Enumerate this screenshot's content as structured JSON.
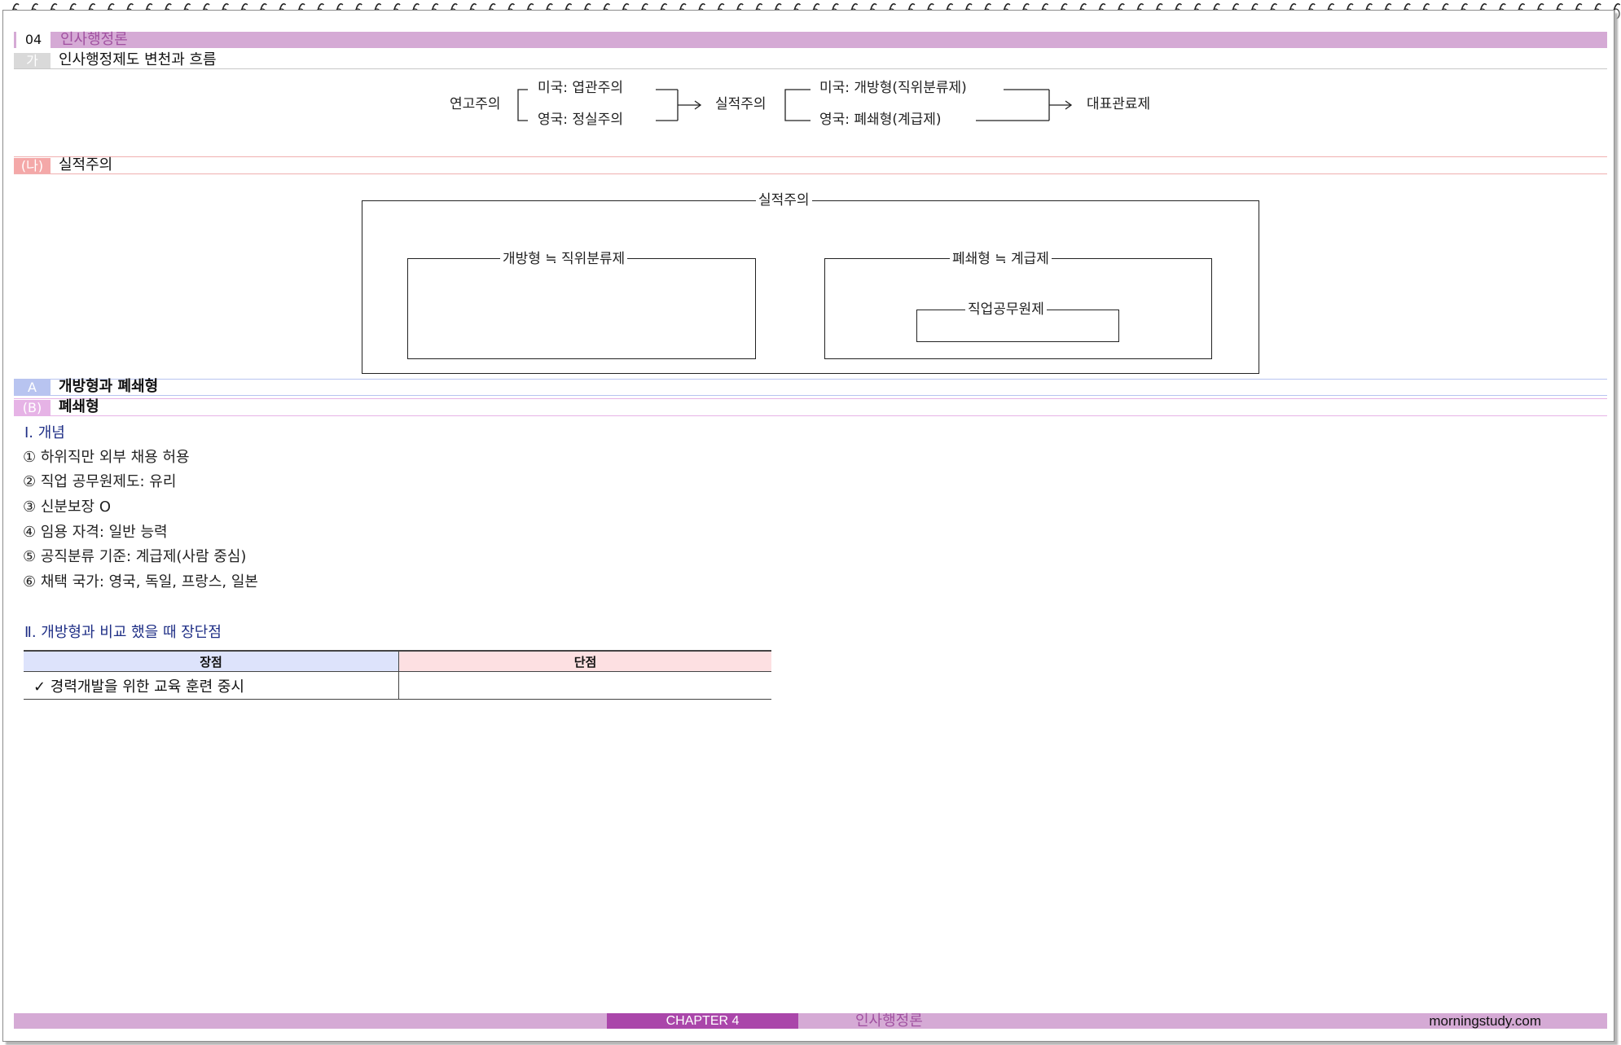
{
  "header": {
    "number": "04",
    "title": "인사행정론"
  },
  "section_ga": {
    "badge": "가",
    "title": "인사행정제도 변천과 흐름"
  },
  "flow": {
    "start": "연고주의",
    "us_patronage": "미국: 엽관주의",
    "uk_patronage": "영국: 정실주의",
    "merit": "실적주의",
    "us_merit": "미국: 개방형(직위분류제)",
    "uk_merit": "영국: 폐쇄형(계급제)",
    "end": "대표관료제"
  },
  "section_na": {
    "badge": "(나)",
    "title": "실적주의"
  },
  "merit_diagram": {
    "outer_label": "실적주의",
    "left_label": "개방형 ≒ 직위분류제",
    "right_label": "폐쇄형 ≒ 계급제",
    "inner_label": "직업공무원제"
  },
  "section_a": {
    "badge": "A",
    "title": "개방형과 폐쇄형"
  },
  "section_b": {
    "badge": "(B)",
    "title": "폐쇄형"
  },
  "concept": {
    "title": "Ⅰ. 개념",
    "items": [
      "① 하위직만 외부 채용 허용",
      "② 직업 공무원제도: 유리",
      "③ 신분보장 O",
      "④ 임용 자격: 일반 능력",
      "⑤ 공직분류 기준: 계급제(사람 중심)",
      "⑥ 채택 국가: 영국, 독일, 프랑스, 일본"
    ]
  },
  "comparison": {
    "title": "Ⅱ. 개방형과 비교 했을 때 장단점",
    "header_pros": "장점",
    "header_cons": "단점",
    "pros_row": "✓ 경력개발을 위한 교육 훈련 중시",
    "cons_row": ""
  },
  "footer": {
    "chapter": "CHAPTER 4",
    "subject": "인사행정론",
    "site": "morningstudy.com"
  },
  "colors": {
    "header_bar": "#d5aad5",
    "badge_gray": "#d9d9d9",
    "badge_salmon": "#f4a8a8",
    "badge_blue": "#b8c4f0",
    "badge_pink": "#e6b3e6",
    "section_title_navy": "#1f2f86",
    "footer_chapter": "#aa46aa"
  }
}
